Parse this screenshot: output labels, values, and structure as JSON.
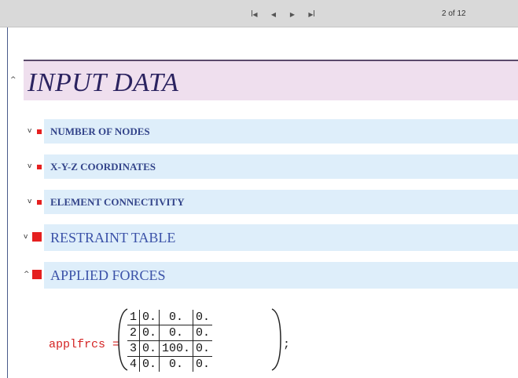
{
  "navigation": {
    "first_icon": "first-page-icon",
    "prev_icon": "previous-page-icon",
    "next_icon": "next-page-icon",
    "last_icon": "last-page-icon",
    "page_counter": "2 of 12"
  },
  "title": {
    "text": "INPUT DATA",
    "toggle": "^"
  },
  "sections": [
    {
      "label": "NUMBER OF NODES",
      "toggle": "v",
      "size": "small",
      "open": false
    },
    {
      "label": "X-Y-Z COORDINATES",
      "toggle": "v",
      "size": "small",
      "open": false
    },
    {
      "label": "ELEMENT CONNECTIVITY",
      "toggle": "v",
      "size": "small",
      "open": false
    },
    {
      "label": "RESTRAINT TABLE",
      "toggle": "v",
      "size": "large",
      "open": false
    },
    {
      "label": "APPLIED FORCES",
      "toggle": "^",
      "size": "large",
      "open": true
    }
  ],
  "formula": {
    "variable": "applfrcs",
    "equals": "=",
    "terminator": ";",
    "matrix": [
      [
        "1",
        "0.",
        "0.",
        "0."
      ],
      [
        "2",
        "0.",
        "0.",
        "0."
      ],
      [
        "3",
        "0.",
        "100.",
        "0."
      ],
      [
        "4",
        "0.",
        "0.",
        "0."
      ]
    ]
  },
  "colors": {
    "title_bg": "#efdfee",
    "title_text": "#2b2360",
    "section_bg": "#deeefa",
    "section_text": "#33448a",
    "marker": "#e52020",
    "variable": "#d42424"
  }
}
